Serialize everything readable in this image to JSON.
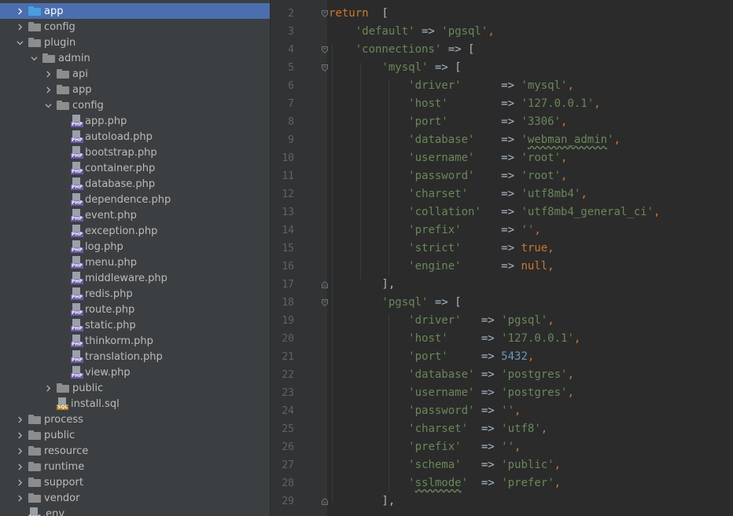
{
  "tree": [
    {
      "label": "app",
      "type": "folder",
      "depth": 0,
      "arrow": "right",
      "selected": true,
      "color": "blue"
    },
    {
      "label": "config",
      "type": "folder",
      "depth": 0,
      "arrow": "right"
    },
    {
      "label": "plugin",
      "type": "folder",
      "depth": 0,
      "arrow": "down"
    },
    {
      "label": "admin",
      "type": "folder",
      "depth": 1,
      "arrow": "down"
    },
    {
      "label": "api",
      "type": "folder",
      "depth": 2,
      "arrow": "right"
    },
    {
      "label": "app",
      "type": "folder",
      "depth": 2,
      "arrow": "right"
    },
    {
      "label": "config",
      "type": "folder",
      "depth": 2,
      "arrow": "down"
    },
    {
      "label": "app.php",
      "type": "php",
      "depth": 3
    },
    {
      "label": "autoload.php",
      "type": "php",
      "depth": 3
    },
    {
      "label": "bootstrap.php",
      "type": "php",
      "depth": 3
    },
    {
      "label": "container.php",
      "type": "php",
      "depth": 3
    },
    {
      "label": "database.php",
      "type": "php",
      "depth": 3
    },
    {
      "label": "dependence.php",
      "type": "php",
      "depth": 3
    },
    {
      "label": "event.php",
      "type": "php",
      "depth": 3
    },
    {
      "label": "exception.php",
      "type": "php",
      "depth": 3
    },
    {
      "label": "log.php",
      "type": "php",
      "depth": 3
    },
    {
      "label": "menu.php",
      "type": "php",
      "depth": 3
    },
    {
      "label": "middleware.php",
      "type": "php",
      "depth": 3
    },
    {
      "label": "redis.php",
      "type": "php",
      "depth": 3
    },
    {
      "label": "route.php",
      "type": "php",
      "depth": 3
    },
    {
      "label": "static.php",
      "type": "php",
      "depth": 3
    },
    {
      "label": "thinkorm.php",
      "type": "php",
      "depth": 3
    },
    {
      "label": "translation.php",
      "type": "php",
      "depth": 3
    },
    {
      "label": "view.php",
      "type": "php",
      "depth": 3
    },
    {
      "label": "public",
      "type": "folder",
      "depth": 2,
      "arrow": "right"
    },
    {
      "label": "install.sql",
      "type": "sql",
      "depth": 2
    },
    {
      "label": "process",
      "type": "folder",
      "depth": 0,
      "arrow": "right"
    },
    {
      "label": "public",
      "type": "folder",
      "depth": 0,
      "arrow": "right"
    },
    {
      "label": "resource",
      "type": "folder",
      "depth": 0,
      "arrow": "right"
    },
    {
      "label": "runtime",
      "type": "folder",
      "depth": 0,
      "arrow": "right"
    },
    {
      "label": "support",
      "type": "folder",
      "depth": 0,
      "arrow": "right"
    },
    {
      "label": "vendor",
      "type": "folder",
      "depth": 0,
      "arrow": "right"
    },
    {
      "label": ".env",
      "type": "env",
      "depth": 0
    }
  ],
  "file_icon_tags": {
    "php": "PHP",
    "sql": "SQL",
    "env": "ENV"
  },
  "code": [
    {
      "n": "2",
      "fold": "open",
      "tokens": [
        {
          "t": "return",
          "k": "keyword"
        },
        {
          "t": "  [",
          "k": "plain"
        }
      ]
    },
    {
      "n": "3",
      "tokens": [
        {
          "t": "    ",
          "k": "plain"
        },
        {
          "t": "'default'",
          "k": "string"
        },
        {
          "t": " => ",
          "k": "plain"
        },
        {
          "t": "'pgsql'",
          "k": "string"
        },
        {
          "t": ",",
          "k": "punct"
        }
      ]
    },
    {
      "n": "4",
      "fold": "open",
      "tokens": [
        {
          "t": "    ",
          "k": "plain"
        },
        {
          "t": "'connections'",
          "k": "string"
        },
        {
          "t": " => [",
          "k": "plain"
        }
      ]
    },
    {
      "n": "5",
      "fold": "open",
      "tokens": [
        {
          "t": "        ",
          "k": "plain"
        },
        {
          "t": "'mysql'",
          "k": "string"
        },
        {
          "t": " => [",
          "k": "plain"
        }
      ]
    },
    {
      "n": "6",
      "tokens": [
        {
          "t": "            ",
          "k": "plain"
        },
        {
          "t": "'driver'",
          "k": "string"
        },
        {
          "t": "      => ",
          "k": "plain"
        },
        {
          "t": "'mysql'",
          "k": "string"
        },
        {
          "t": ",",
          "k": "punct"
        }
      ]
    },
    {
      "n": "7",
      "tokens": [
        {
          "t": "            ",
          "k": "plain"
        },
        {
          "t": "'host'",
          "k": "string"
        },
        {
          "t": "        => ",
          "k": "plain"
        },
        {
          "t": "'127.0.0.1'",
          "k": "string"
        },
        {
          "t": ",",
          "k": "punct"
        }
      ]
    },
    {
      "n": "8",
      "tokens": [
        {
          "t": "            ",
          "k": "plain"
        },
        {
          "t": "'port'",
          "k": "string"
        },
        {
          "t": "        => ",
          "k": "plain"
        },
        {
          "t": "'3306'",
          "k": "string"
        },
        {
          "t": ",",
          "k": "punct"
        }
      ]
    },
    {
      "n": "9",
      "tokens": [
        {
          "t": "            ",
          "k": "plain"
        },
        {
          "t": "'database'",
          "k": "string"
        },
        {
          "t": "    => ",
          "k": "plain"
        },
        {
          "t": "'",
          "k": "string"
        },
        {
          "t": "webman_admin",
          "k": "string",
          "wavy": true
        },
        {
          "t": "'",
          "k": "string"
        },
        {
          "t": ",",
          "k": "punct"
        }
      ]
    },
    {
      "n": "10",
      "tokens": [
        {
          "t": "            ",
          "k": "plain"
        },
        {
          "t": "'username'",
          "k": "string"
        },
        {
          "t": "    => ",
          "k": "plain"
        },
        {
          "t": "'root'",
          "k": "string"
        },
        {
          "t": ",",
          "k": "punct"
        }
      ]
    },
    {
      "n": "11",
      "tokens": [
        {
          "t": "            ",
          "k": "plain"
        },
        {
          "t": "'password'",
          "k": "string"
        },
        {
          "t": "    => ",
          "k": "plain"
        },
        {
          "t": "'root'",
          "k": "string"
        },
        {
          "t": ",",
          "k": "punct"
        }
      ]
    },
    {
      "n": "12",
      "tokens": [
        {
          "t": "            ",
          "k": "plain"
        },
        {
          "t": "'charset'",
          "k": "string"
        },
        {
          "t": "     => ",
          "k": "plain"
        },
        {
          "t": "'utf8mb4'",
          "k": "string"
        },
        {
          "t": ",",
          "k": "punct"
        }
      ]
    },
    {
      "n": "13",
      "tokens": [
        {
          "t": "            ",
          "k": "plain"
        },
        {
          "t": "'collation'",
          "k": "string"
        },
        {
          "t": "   => ",
          "k": "plain"
        },
        {
          "t": "'utf8mb4_general_ci'",
          "k": "string"
        },
        {
          "t": ",",
          "k": "punct"
        }
      ]
    },
    {
      "n": "14",
      "tokens": [
        {
          "t": "            ",
          "k": "plain"
        },
        {
          "t": "'prefix'",
          "k": "string"
        },
        {
          "t": "      => ",
          "k": "plain"
        },
        {
          "t": "''",
          "k": "string"
        },
        {
          "t": ",",
          "k": "punct"
        }
      ]
    },
    {
      "n": "15",
      "tokens": [
        {
          "t": "            ",
          "k": "plain"
        },
        {
          "t": "'strict'",
          "k": "string"
        },
        {
          "t": "      => ",
          "k": "plain"
        },
        {
          "t": "true",
          "k": "keyword"
        },
        {
          "t": ",",
          "k": "punct"
        }
      ]
    },
    {
      "n": "16",
      "tokens": [
        {
          "t": "            ",
          "k": "plain"
        },
        {
          "t": "'engine'",
          "k": "string"
        },
        {
          "t": "      => ",
          "k": "plain"
        },
        {
          "t": "null",
          "k": "keyword"
        },
        {
          "t": ",",
          "k": "punct"
        }
      ]
    },
    {
      "n": "17",
      "fold": "close",
      "tokens": [
        {
          "t": "        ],",
          "k": "plain"
        }
      ]
    },
    {
      "n": "18",
      "fold": "open",
      "tokens": [
        {
          "t": "        ",
          "k": "plain"
        },
        {
          "t": "'pgsql'",
          "k": "string"
        },
        {
          "t": " => [",
          "k": "plain"
        }
      ]
    },
    {
      "n": "19",
      "tokens": [
        {
          "t": "            ",
          "k": "plain"
        },
        {
          "t": "'driver'",
          "k": "string"
        },
        {
          "t": "   => ",
          "k": "plain"
        },
        {
          "t": "'pgsql'",
          "k": "string"
        },
        {
          "t": ",",
          "k": "punct"
        }
      ]
    },
    {
      "n": "20",
      "tokens": [
        {
          "t": "            ",
          "k": "plain"
        },
        {
          "t": "'host'",
          "k": "string"
        },
        {
          "t": "     => ",
          "k": "plain"
        },
        {
          "t": "'127.0.0.1'",
          "k": "string"
        },
        {
          "t": ",",
          "k": "punct"
        }
      ]
    },
    {
      "n": "21",
      "tokens": [
        {
          "t": "            ",
          "k": "plain"
        },
        {
          "t": "'port'",
          "k": "string"
        },
        {
          "t": "     => ",
          "k": "plain"
        },
        {
          "t": "5432",
          "k": "number"
        },
        {
          "t": ",",
          "k": "punct"
        }
      ]
    },
    {
      "n": "22",
      "tokens": [
        {
          "t": "            ",
          "k": "plain"
        },
        {
          "t": "'database'",
          "k": "string"
        },
        {
          "t": " => ",
          "k": "plain"
        },
        {
          "t": "'postgres'",
          "k": "string"
        },
        {
          "t": ",",
          "k": "punct"
        }
      ]
    },
    {
      "n": "23",
      "tokens": [
        {
          "t": "            ",
          "k": "plain"
        },
        {
          "t": "'username'",
          "k": "string"
        },
        {
          "t": " => ",
          "k": "plain"
        },
        {
          "t": "'postgres'",
          "k": "string"
        },
        {
          "t": ",",
          "k": "punct"
        }
      ]
    },
    {
      "n": "24",
      "tokens": [
        {
          "t": "            ",
          "k": "plain"
        },
        {
          "t": "'password'",
          "k": "string"
        },
        {
          "t": " => ",
          "k": "plain"
        },
        {
          "t": "''",
          "k": "string"
        },
        {
          "t": ",",
          "k": "punct"
        }
      ]
    },
    {
      "n": "25",
      "tokens": [
        {
          "t": "            ",
          "k": "plain"
        },
        {
          "t": "'charset'",
          "k": "string"
        },
        {
          "t": "  => ",
          "k": "plain"
        },
        {
          "t": "'utf8'",
          "k": "string"
        },
        {
          "t": ",",
          "k": "punct"
        }
      ]
    },
    {
      "n": "26",
      "tokens": [
        {
          "t": "            ",
          "k": "plain"
        },
        {
          "t": "'prefix'",
          "k": "string"
        },
        {
          "t": "   => ",
          "k": "plain"
        },
        {
          "t": "''",
          "k": "string"
        },
        {
          "t": ",",
          "k": "punct"
        }
      ]
    },
    {
      "n": "27",
      "tokens": [
        {
          "t": "            ",
          "k": "plain"
        },
        {
          "t": "'schema'",
          "k": "string"
        },
        {
          "t": "   => ",
          "k": "plain"
        },
        {
          "t": "'public'",
          "k": "string"
        },
        {
          "t": ",",
          "k": "punct"
        }
      ]
    },
    {
      "n": "28",
      "tokens": [
        {
          "t": "            ",
          "k": "plain"
        },
        {
          "t": "'",
          "k": "string"
        },
        {
          "t": "sslmode",
          "k": "string",
          "wavy": true
        },
        {
          "t": "'",
          "k": "string"
        },
        {
          "t": "  => ",
          "k": "plain"
        },
        {
          "t": "'prefer'",
          "k": "string"
        },
        {
          "t": ",",
          "k": "punct"
        }
      ]
    },
    {
      "n": "29",
      "fold": "close",
      "tokens": [
        {
          "t": "        ],",
          "k": "plain"
        }
      ]
    }
  ]
}
